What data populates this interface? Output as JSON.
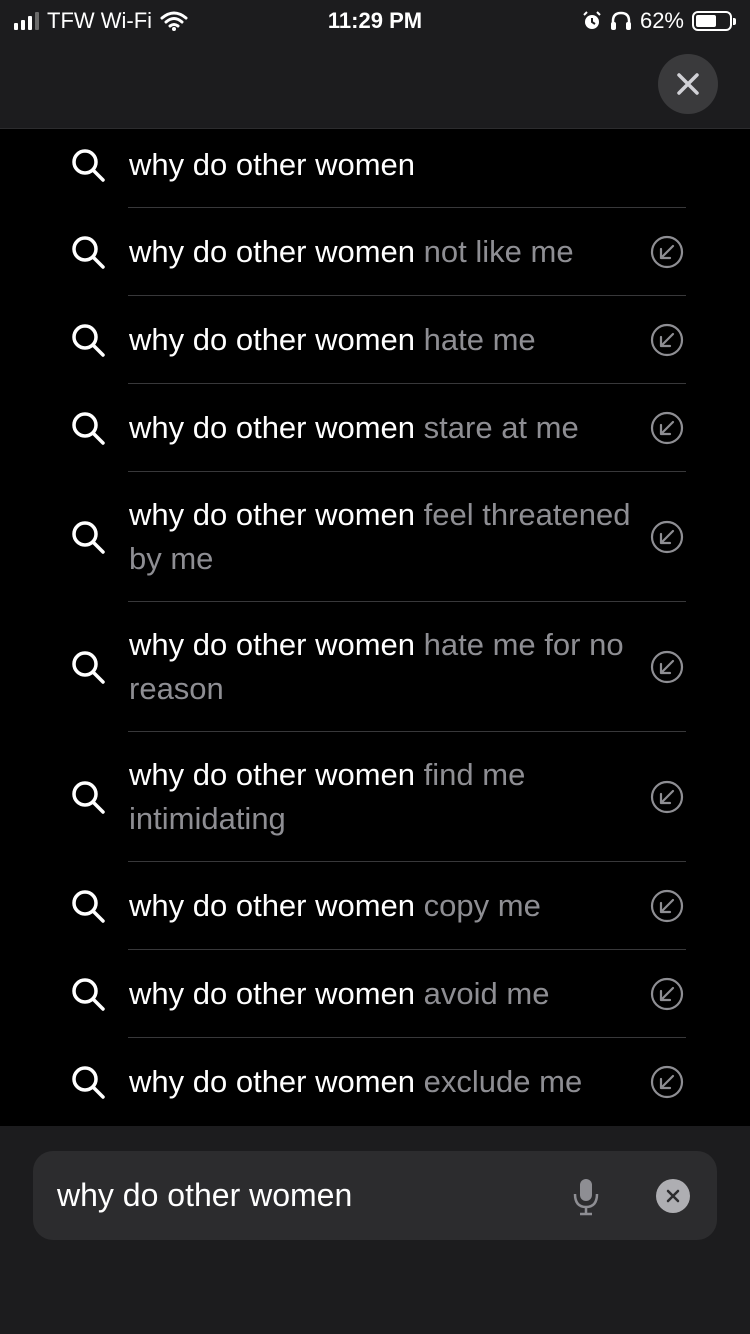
{
  "status_bar": {
    "carrier": "TFW Wi-Fi",
    "time": "11:29 PM",
    "battery_percent": "62%",
    "battery_level": 0.62
  },
  "header": {
    "close_icon": "close-icon"
  },
  "suggestions": [
    {
      "typed": "why do other women",
      "rest": ""
    },
    {
      "typed": "why do other women",
      "rest": " not like me"
    },
    {
      "typed": "why do other women",
      "rest": " hate me"
    },
    {
      "typed": "why do other women",
      "rest": " stare at me"
    },
    {
      "typed": "why do other women",
      "rest": " feel threatened by me"
    },
    {
      "typed": "why do other women",
      "rest": " hate me for no reason"
    },
    {
      "typed": "why do other women",
      "rest": " find me intimidating"
    },
    {
      "typed": "why do other women",
      "rest": " copy me"
    },
    {
      "typed": "why do other women",
      "rest": " avoid me"
    },
    {
      "typed": "why do other women",
      "rest": " exclude me"
    }
  ],
  "search": {
    "value": "why do other women",
    "mic_icon": "microphone-icon",
    "clear_icon": "clear-icon"
  },
  "colors": {
    "background": "#000000",
    "bar": "#1c1c1e",
    "secondary_text": "#8e8e93"
  }
}
